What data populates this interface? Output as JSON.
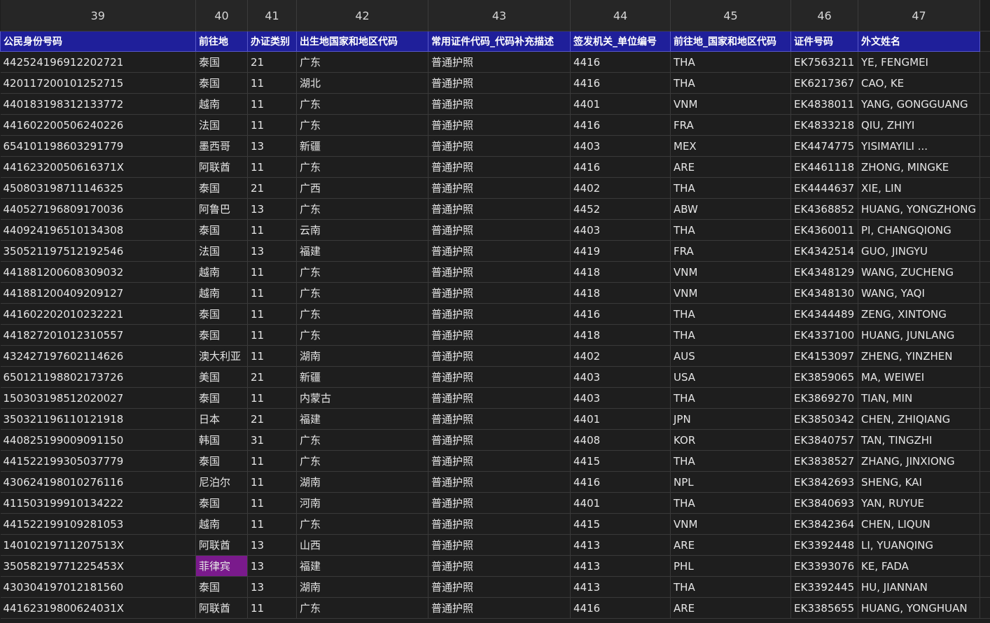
{
  "column_numbers": [
    "39",
    "40",
    "41",
    "42",
    "43",
    "44",
    "45",
    "46",
    "47"
  ],
  "headers": [
    "公民身份号码",
    "前往地",
    "办证类别",
    "出生地国家和地区代码",
    "常用证件代码_代码补充描述",
    "签发机关_单位编号",
    "前往地_国家和地区代码",
    "证件号码",
    "外文姓名"
  ],
  "highlight_color": "#7a1a8c",
  "rows": [
    [
      "442524196912202721",
      "泰国",
      "21",
      "广东",
      "普通护照",
      "4416",
      "THA",
      "EK7563211",
      "YE, FENGMEI"
    ],
    [
      "420117200101252715",
      "泰国",
      "11",
      "湖北",
      "普通护照",
      "4416",
      "THA",
      "EK6217367",
      "CAO, KE"
    ],
    [
      "440183198312133772",
      "越南",
      "11",
      "广东",
      "普通护照",
      "4401",
      "VNM",
      "EK4838011",
      "YANG, GONGGUANG"
    ],
    [
      "441602200506240226",
      "法国",
      "11",
      "广东",
      "普通护照",
      "4416",
      "FRA",
      "EK4833218",
      "QIU, ZHIYI"
    ],
    [
      "654101198603291779",
      "墨西哥",
      "13",
      "新疆",
      "普通护照",
      "4403",
      "MEX",
      "EK4474775",
      "YISIMAYILI ..."
    ],
    [
      "44162320050616371X",
      "阿联酋",
      "11",
      "广东",
      "普通护照",
      "4416",
      "ARE",
      "EK4461118",
      "ZHONG, MINGKE"
    ],
    [
      "450803198711146325",
      "泰国",
      "21",
      "广西",
      "普通护照",
      "4402",
      "THA",
      "EK4444637",
      "XIE, LIN"
    ],
    [
      "440527196809170036",
      "阿鲁巴",
      "13",
      "广东",
      "普通护照",
      "4452",
      "ABW",
      "EK4368852",
      "HUANG, YONGZHONG"
    ],
    [
      "440924196510134308",
      "泰国",
      "11",
      "云南",
      "普通护照",
      "4403",
      "THA",
      "EK4360011",
      "PI, CHANGQIONG"
    ],
    [
      "350521197512192546",
      "法国",
      "13",
      "福建",
      "普通护照",
      "4419",
      "FRA",
      "EK4342514",
      "GUO, JINGYU"
    ],
    [
      "441881200608309032",
      "越南",
      "11",
      "广东",
      "普通护照",
      "4418",
      "VNM",
      "EK4348129",
      "WANG, ZUCHENG"
    ],
    [
      "441881200409209127",
      "越南",
      "11",
      "广东",
      "普通护照",
      "4418",
      "VNM",
      "EK4348130",
      "WANG, YAQI"
    ],
    [
      "441602202010232221",
      "泰国",
      "11",
      "广东",
      "普通护照",
      "4416",
      "THA",
      "EK4344489",
      "ZENG, XINTONG"
    ],
    [
      "441827201012310557",
      "泰国",
      "11",
      "广东",
      "普通护照",
      "4418",
      "THA",
      "EK4337100",
      "HUANG, JUNLANG"
    ],
    [
      "432427197602114626",
      "澳大利亚",
      "11",
      "湖南",
      "普通护照",
      "4402",
      "AUS",
      "EK4153097",
      "ZHENG, YINZHEN"
    ],
    [
      "650121198802173726",
      "美国",
      "21",
      "新疆",
      "普通护照",
      "4403",
      "USA",
      "EK3859065",
      "MA, WEIWEI"
    ],
    [
      "150303198512020027",
      "泰国",
      "11",
      "内蒙古",
      "普通护照",
      "4403",
      "THA",
      "EK3869270",
      "TIAN, MIN"
    ],
    [
      "350321196110121918",
      "日本",
      "21",
      "福建",
      "普通护照",
      "4401",
      "JPN",
      "EK3850342",
      "CHEN, ZHIQIANG"
    ],
    [
      "440825199009091150",
      "韩国",
      "31",
      "广东",
      "普通护照",
      "4408",
      "KOR",
      "EK3840757",
      "TAN, TINGZHI"
    ],
    [
      "441522199305037779",
      "泰国",
      "11",
      "广东",
      "普通护照",
      "4415",
      "THA",
      "EK3838527",
      "ZHANG, JINXIONG"
    ],
    [
      "430624198010276116",
      "尼泊尔",
      "11",
      "湖南",
      "普通护照",
      "4416",
      "NPL",
      "EK3842693",
      "SHENG, KAI"
    ],
    [
      "411503199910134222",
      "泰国",
      "11",
      "河南",
      "普通护照",
      "4401",
      "THA",
      "EK3840693",
      "YAN, RUYUE"
    ],
    [
      "441522199109281053",
      "越南",
      "11",
      "广东",
      "普通护照",
      "4415",
      "VNM",
      "EK3842364",
      "CHEN, LIQUN"
    ],
    [
      "14010219711207513X",
      "阿联酋",
      "13",
      "山西",
      "普通护照",
      "4413",
      "ARE",
      "EK3392448",
      "LI, YUANQING"
    ],
    [
      "35058219771225453X",
      "菲律宾",
      "13",
      "福建",
      "普通护照",
      "4413",
      "PHL",
      "EK3393076",
      "KE, FADA"
    ],
    [
      "430304197012181560",
      "泰国",
      "13",
      "湖南",
      "普通护照",
      "4413",
      "THA",
      "EK3392445",
      "HU, JIANNAN"
    ],
    [
      "44162319800624031X",
      "阿联酋",
      "11",
      "广东",
      "普通护照",
      "4416",
      "ARE",
      "EK3385655",
      "HUANG, YONGHUAN"
    ]
  ],
  "highlighted_cell": {
    "row": 24,
    "col": 1
  }
}
